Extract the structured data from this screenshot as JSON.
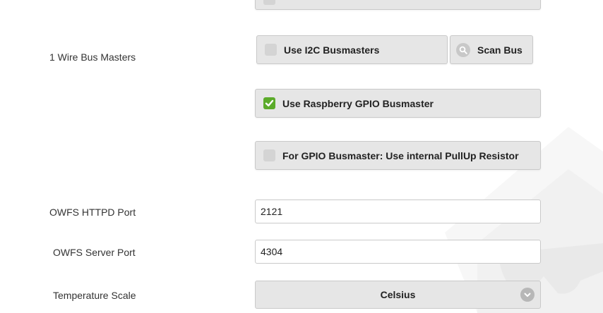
{
  "labels": {
    "bus_masters": "1 Wire Bus Masters",
    "httpd_port": "OWFS HTTPD Port",
    "server_port": "OWFS Server Port",
    "temp_scale": "Temperature Scale"
  },
  "buttons": {
    "i2c": "Use I2C Busmasters",
    "scan": "Scan Bus",
    "gpio": "Use Raspberry GPIO Busmaster",
    "pullup": "For GPIO Busmaster: Use internal PullUp Resistor"
  },
  "checkboxes": {
    "top_partial": false,
    "i2c": false,
    "gpio": true,
    "pullup": false
  },
  "inputs": {
    "httpd_port": "2121",
    "server_port": "4304"
  },
  "select": {
    "temp_scale_value": "Celsius"
  },
  "colors": {
    "checked": "#5bab2a",
    "unchecked": "#d4d4d4",
    "button_bg": "#e6e6e6"
  },
  "icons": [
    "check-icon",
    "search-icon",
    "chevron-down-icon"
  ]
}
